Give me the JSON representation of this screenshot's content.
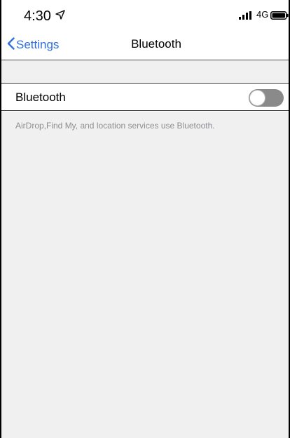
{
  "status_bar": {
    "time": "4:30",
    "network": "4G",
    "icons": [
      "location-arrow-icon",
      "signal-bars-icon",
      "battery-icon"
    ]
  },
  "nav": {
    "back_label": "Settings",
    "title": "Bluetooth"
  },
  "bluetooth_row": {
    "label": "Bluetooth",
    "toggle_on": false
  },
  "footer": {
    "description": "AirDrop,Find My, and location services use Bluetooth."
  },
  "colors": {
    "accent": "#2f6fe0",
    "toggle_off": "#8a8a8a",
    "group_background": "#f0f0f0",
    "footer_text": "#8e8e93"
  }
}
